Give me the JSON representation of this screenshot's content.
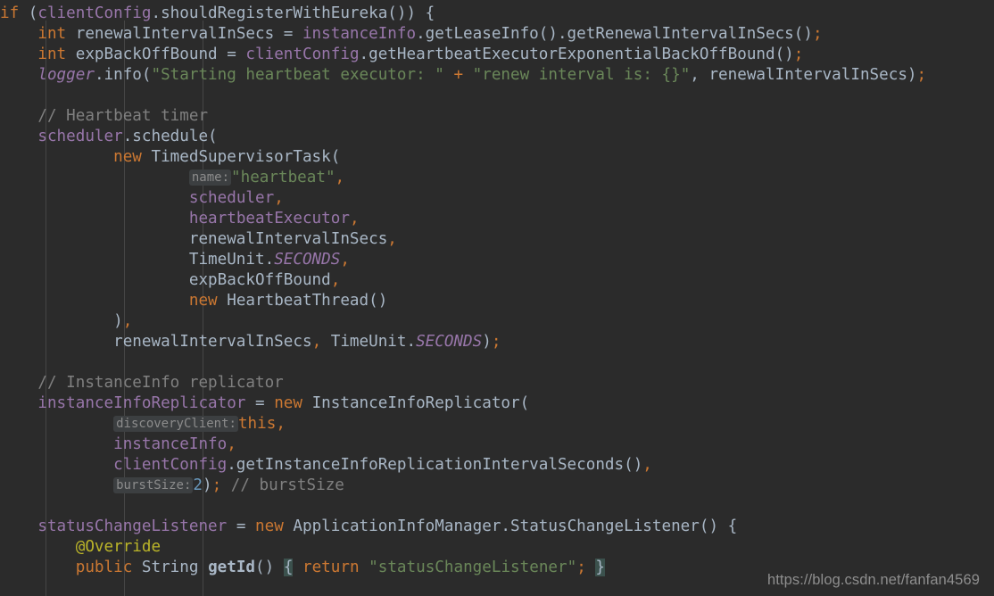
{
  "editor": {
    "theme": "darcula",
    "background": "#2b2b2b",
    "language": "java",
    "font_size_px": 17.6,
    "line_height_px": 23,
    "colors": {
      "background": "#2b2b2b",
      "default_text": "#a9b7c6",
      "keyword": "#cc7832",
      "string": "#6a8759",
      "comment": "#808080",
      "number": "#6897bb",
      "field": "#9876aa",
      "static_field": "#9876aa",
      "param_hint_bg": "#3c3f41",
      "param_hint_fg": "#8c8c8c",
      "brace_highlight_bg": "#3b514d",
      "indent_guide": "#4b4b4b",
      "watermark": "#8e8e8e"
    },
    "indent_guides": [
      51,
      139,
      227
    ],
    "lines": [
      {
        "n": 1,
        "tokens": [
          {
            "t": "if",
            "c": "kw"
          },
          {
            "t": " (",
            "c": "punc"
          },
          {
            "t": "clientConfig",
            "c": "field"
          },
          {
            "t": ".shouldRegisterWithEureka()) {",
            "c": "ident"
          }
        ]
      },
      {
        "n": 2,
        "tokens": [
          {
            "t": "    ",
            "c": "punc"
          },
          {
            "t": "int",
            "c": "kw"
          },
          {
            "t": " renewalIntervalInSecs = ",
            "c": "local"
          },
          {
            "t": "instanceInfo",
            "c": "field"
          },
          {
            "t": ".getLeaseInfo().getRenewalIntervalInSecs()",
            "c": "ident"
          },
          {
            "t": ";",
            "c": "kw"
          }
        ]
      },
      {
        "n": 3,
        "tokens": [
          {
            "t": "    ",
            "c": "punc"
          },
          {
            "t": "int",
            "c": "kw"
          },
          {
            "t": " expBackOffBound = ",
            "c": "local"
          },
          {
            "t": "clientConfig",
            "c": "field"
          },
          {
            "t": ".getHeartbeatExecutorExponentialBackOffBound()",
            "c": "ident"
          },
          {
            "t": ";",
            "c": "kw"
          }
        ]
      },
      {
        "n": 4,
        "tokens": [
          {
            "t": "    ",
            "c": "punc"
          },
          {
            "t": "logger",
            "c": "static"
          },
          {
            "t": ".info(",
            "c": "ident"
          },
          {
            "t": "\"Starting heartbeat executor: \"",
            "c": "str"
          },
          {
            "t": " + ",
            "c": "kw"
          },
          {
            "t": "\"renew interval is: {}\"",
            "c": "str"
          },
          {
            "t": ", renewalIntervalInSecs)",
            "c": "local"
          },
          {
            "t": ";",
            "c": "kw"
          }
        ]
      },
      {
        "n": 5,
        "tokens": []
      },
      {
        "n": 6,
        "tokens": [
          {
            "t": "    ",
            "c": "punc"
          },
          {
            "t": "// Heartbeat timer",
            "c": "cmt"
          }
        ]
      },
      {
        "n": 7,
        "tokens": [
          {
            "t": "    ",
            "c": "punc"
          },
          {
            "t": "scheduler",
            "c": "field"
          },
          {
            "t": ".schedule(",
            "c": "ident"
          }
        ]
      },
      {
        "n": 8,
        "tokens": [
          {
            "t": "            ",
            "c": "punc"
          },
          {
            "t": "new",
            "c": "kw"
          },
          {
            "t": " TimedSupervisorTask(",
            "c": "ident"
          }
        ]
      },
      {
        "n": 9,
        "hint": {
          "text": "name:",
          "indent": 20
        },
        "tokens": [
          {
            "t": "\"heartbeat\"",
            "c": "str"
          },
          {
            "t": ",",
            "c": "kw"
          }
        ]
      },
      {
        "n": 10,
        "tokens": [
          {
            "t": "                    ",
            "c": "punc"
          },
          {
            "t": "scheduler",
            "c": "field"
          },
          {
            "t": ",",
            "c": "kw"
          }
        ]
      },
      {
        "n": 11,
        "tokens": [
          {
            "t": "                    ",
            "c": "punc"
          },
          {
            "t": "heartbeatExecutor",
            "c": "field"
          },
          {
            "t": ",",
            "c": "kw"
          }
        ]
      },
      {
        "n": 12,
        "tokens": [
          {
            "t": "                    renewalIntervalInSecs",
            "c": "local"
          },
          {
            "t": ",",
            "c": "kw"
          }
        ]
      },
      {
        "n": 13,
        "tokens": [
          {
            "t": "                    TimeUnit.",
            "c": "ident"
          },
          {
            "t": "SECONDS",
            "c": "static"
          },
          {
            "t": ",",
            "c": "kw"
          }
        ]
      },
      {
        "n": 14,
        "tokens": [
          {
            "t": "                    expBackOffBound",
            "c": "local"
          },
          {
            "t": ",",
            "c": "kw"
          }
        ]
      },
      {
        "n": 15,
        "tokens": [
          {
            "t": "                    ",
            "c": "punc"
          },
          {
            "t": "new",
            "c": "kw"
          },
          {
            "t": " HeartbeatThread()",
            "c": "ident"
          }
        ]
      },
      {
        "n": 16,
        "tokens": [
          {
            "t": "            )",
            "c": "ident"
          },
          {
            "t": ",",
            "c": "kw"
          }
        ]
      },
      {
        "n": 17,
        "tokens": [
          {
            "t": "            renewalIntervalInSecs",
            "c": "local"
          },
          {
            "t": ",",
            "c": "kw"
          },
          {
            "t": " TimeUnit.",
            "c": "ident"
          },
          {
            "t": "SECONDS",
            "c": "static"
          },
          {
            "t": ")",
            "c": "ident"
          },
          {
            "t": ";",
            "c": "kw"
          }
        ]
      },
      {
        "n": 18,
        "tokens": []
      },
      {
        "n": 19,
        "tokens": [
          {
            "t": "    ",
            "c": "punc"
          },
          {
            "t": "// InstanceInfo replicator",
            "c": "cmt"
          }
        ]
      },
      {
        "n": 20,
        "tokens": [
          {
            "t": "    ",
            "c": "punc"
          },
          {
            "t": "instanceInfoReplicator",
            "c": "field"
          },
          {
            "t": " = ",
            "c": "local"
          },
          {
            "t": "new",
            "c": "kw"
          },
          {
            "t": " InstanceInfoReplicator(",
            "c": "ident"
          }
        ]
      },
      {
        "n": 21,
        "hint": {
          "text": "discoveryClient:",
          "indent": 12
        },
        "tokens": [
          {
            "t": "this",
            "c": "kw"
          },
          {
            "t": ",",
            "c": "kw"
          }
        ]
      },
      {
        "n": 22,
        "tokens": [
          {
            "t": "            ",
            "c": "punc"
          },
          {
            "t": "instanceInfo",
            "c": "field"
          },
          {
            "t": ",",
            "c": "kw"
          }
        ]
      },
      {
        "n": 23,
        "tokens": [
          {
            "t": "            ",
            "c": "punc"
          },
          {
            "t": "clientConfig",
            "c": "field"
          },
          {
            "t": ".getInstanceInfoReplicationIntervalSeconds()",
            "c": "ident"
          },
          {
            "t": ",",
            "c": "kw"
          }
        ]
      },
      {
        "n": 24,
        "hint": {
          "text": "burstSize:",
          "indent": 12
        },
        "tokens": [
          {
            "t": "2",
            "c": "num"
          },
          {
            "t": ")",
            "c": "ident"
          },
          {
            "t": ";",
            "c": "kw"
          },
          {
            "t": " ",
            "c": "punc"
          },
          {
            "t": "// burstSize",
            "c": "cmt"
          }
        ]
      },
      {
        "n": 25,
        "tokens": []
      },
      {
        "n": 26,
        "tokens": [
          {
            "t": "    ",
            "c": "punc"
          },
          {
            "t": "statusChangeListener",
            "c": "field"
          },
          {
            "t": " = ",
            "c": "local"
          },
          {
            "t": "new",
            "c": "kw"
          },
          {
            "t": " ApplicationInfoManager.StatusChangeListener() {",
            "c": "ident"
          }
        ]
      },
      {
        "n": 27,
        "tokens": [
          {
            "t": "        ",
            "c": "punc"
          },
          {
            "t": "@Override",
            "c": "anno"
          }
        ]
      },
      {
        "n": 28,
        "tokens": [
          {
            "t": "        ",
            "c": "punc"
          },
          {
            "t": "public",
            "c": "kw"
          },
          {
            "t": " String ",
            "c": "ident"
          },
          {
            "t": "getId",
            "c": "bold"
          },
          {
            "t": "() ",
            "c": "ident"
          },
          {
            "t": "{",
            "c": "brace-hl"
          },
          {
            "t": " ",
            "c": "punc"
          },
          {
            "t": "return",
            "c": "kw"
          },
          {
            "t": " ",
            "c": "punc"
          },
          {
            "t": "\"statusChangeListener\"",
            "c": "str"
          },
          {
            "t": ";",
            "c": "kw"
          },
          {
            "t": " ",
            "c": "punc"
          },
          {
            "t": "}",
            "c": "brace-hl"
          }
        ]
      }
    ]
  },
  "watermark": {
    "text": "https://blog.csdn.net/fanfan4569"
  }
}
